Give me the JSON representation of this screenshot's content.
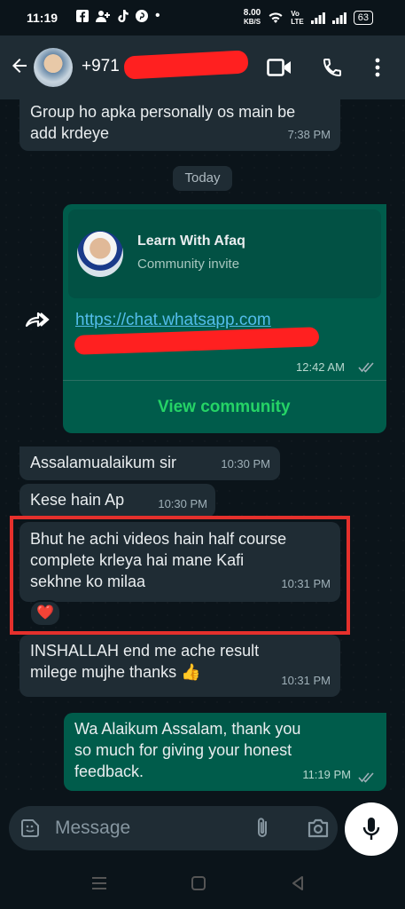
{
  "status_bar": {
    "time": "11:19",
    "speed_value": "8.00",
    "speed_unit": "KB/S",
    "volte_top": "Vo",
    "volte_bottom": "LTE",
    "battery": "63"
  },
  "header": {
    "contact_name": "+971"
  },
  "messages": [
    {
      "line1": "Group ho apka personally os main be",
      "line2": "add krdeye",
      "time": "7:38 PM"
    },
    {
      "date_chip": "Today"
    },
    {
      "card_title": "Learn With Afaq",
      "card_subtitle": "Community invite",
      "link_text": "https://chat.whatsapp.com",
      "time": "12:42 AM",
      "action": "View community"
    },
    {
      "text": "Assalamualaikum sir",
      "time": "10:30 PM"
    },
    {
      "text": "Kese hain Ap",
      "time": "10:30 PM"
    },
    {
      "line1": "Bhut he achi videos hain half course",
      "line2": "complete krleya hai mane Kafi",
      "line3": "sekhne ko milaa",
      "time": "10:31 PM",
      "reaction": "❤️"
    },
    {
      "line1": "INSHALLAH end me ache result",
      "line2": "milege mujhe thanks 👍",
      "time": "10:31 PM"
    },
    {
      "line1": "Wa Alaikum Assalam, thank you",
      "line2": "so much for giving your honest",
      "line3": "feedback.",
      "time": "11:19 PM"
    }
  ],
  "composer": {
    "placeholder": "Message"
  },
  "colors": {
    "background": "#0b141a",
    "incoming": "#1f2c34",
    "outgoing": "#005c4b",
    "link": "#53bdeb",
    "accent": "#25d366",
    "highlight": "#e5302c",
    "redaction": "#ff2020"
  }
}
